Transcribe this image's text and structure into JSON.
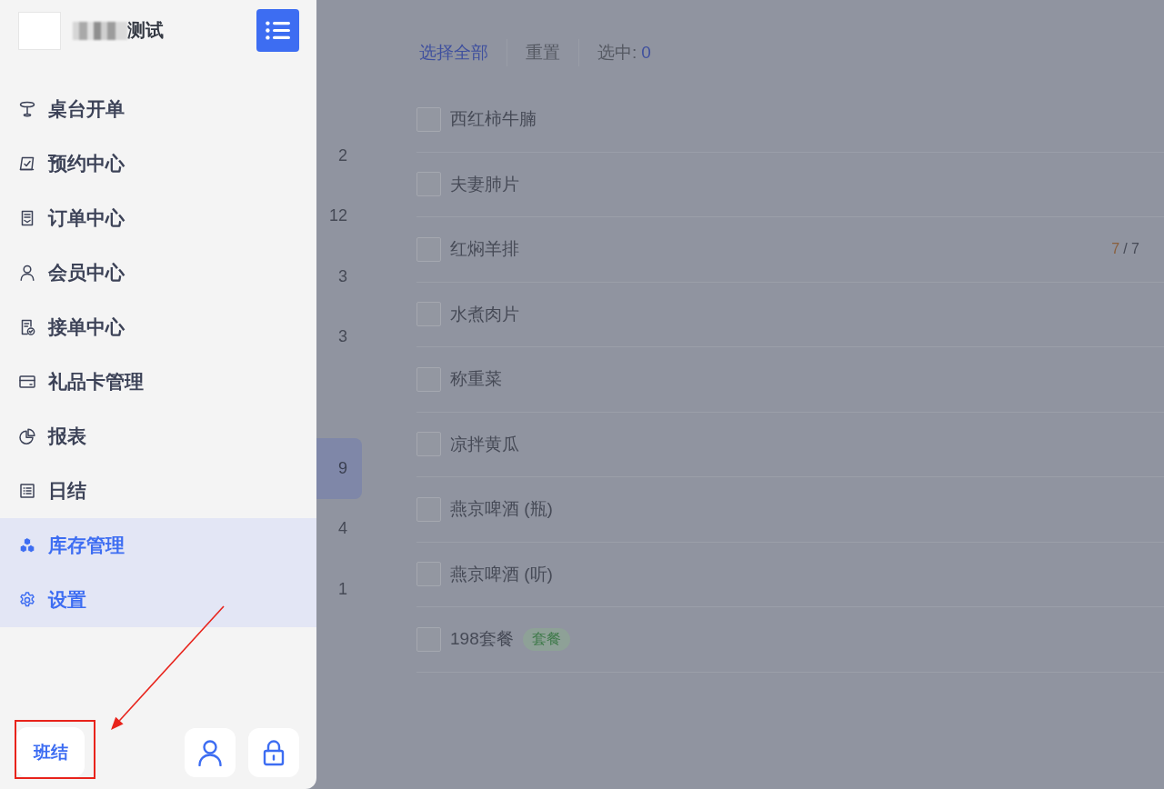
{
  "drawer": {
    "title": {
      "text": "测试",
      "blurred_prefix": true
    },
    "menu": [
      {
        "label": "桌台开单",
        "selected": false
      },
      {
        "label": "预约中心",
        "selected": false
      },
      {
        "label": "订单中心",
        "selected": false
      },
      {
        "label": "会员中心",
        "selected": false
      },
      {
        "label": "接单中心",
        "selected": false
      },
      {
        "label": "礼品卡管理",
        "selected": false
      },
      {
        "label": "报表",
        "selected": false
      },
      {
        "label": "日结",
        "selected": false
      },
      {
        "label": "库存管理",
        "selected": true
      },
      {
        "label": "设置",
        "selected": true
      }
    ],
    "footer": {
      "shift_button": "班结"
    }
  },
  "annotation": {
    "frame": true,
    "arrow": true
  },
  "categories": [
    {
      "count": "2",
      "selected": false
    },
    {
      "count": "12",
      "selected": false
    },
    {
      "count": "3",
      "selected": false
    },
    {
      "count": "3",
      "selected": false
    },
    {
      "selected": false
    },
    {
      "count": "9",
      "selected": true
    },
    {
      "count": "4",
      "selected": false
    },
    {
      "count": "1",
      "selected": false
    }
  ],
  "toolbar": {
    "select_all": "选择全部",
    "reset": "重置",
    "selected_label": "选中:",
    "selected_count": "0"
  },
  "dishes": [
    {
      "name": "西红柿牛腩",
      "checked": false
    },
    {
      "name": "夫妻肺片",
      "checked": false
    },
    {
      "name": "红焖羊排",
      "checked": false,
      "stock_count": "7",
      "stock_total": "/ 7"
    },
    {
      "name": "水煮肉片",
      "checked": false
    },
    {
      "name": "称重菜",
      "checked": false
    },
    {
      "name": "凉拌黄瓜",
      "checked": false
    },
    {
      "name": "燕京啤酒 (瓶)",
      "checked": false
    },
    {
      "name": "燕京啤酒 (听)",
      "checked": false
    },
    {
      "name": "198套餐",
      "checked": false,
      "tag": "套餐"
    }
  ]
}
